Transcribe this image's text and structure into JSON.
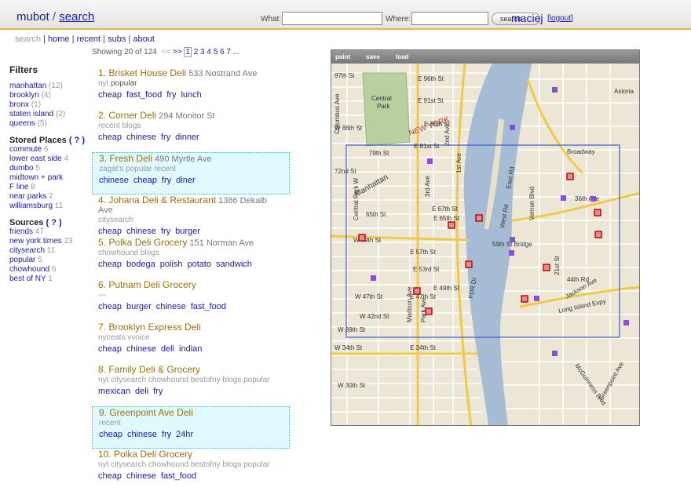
{
  "header": {
    "app": "mubot",
    "separator": "/",
    "section": "search",
    "what_label": "What:",
    "where_label": "Where:",
    "search_button": "search",
    "user": "maciej",
    "logout": "logout"
  },
  "nav": {
    "current": "search",
    "items": [
      "home",
      "recent",
      "subs",
      "about"
    ]
  },
  "sidebar": {
    "filters_title": "Filters",
    "filters": [
      {
        "label": "manhattan",
        "count": "(12)"
      },
      {
        "label": "brooklyn",
        "count": "(4)"
      },
      {
        "label": "bronx",
        "count": "(1)"
      },
      {
        "label": "staten island",
        "count": "(2)"
      },
      {
        "label": "queens",
        "count": "(5)"
      }
    ],
    "places_title": "Stored Places",
    "help": "( ? )",
    "places": [
      {
        "label": "commute",
        "count": "6"
      },
      {
        "label": "lower east side",
        "count": "4"
      },
      {
        "label": "dumbo",
        "count": "5"
      },
      {
        "label": "midtown + park",
        "count": ""
      },
      {
        "label": "F line",
        "count": "8"
      },
      {
        "label": "near parks",
        "count": "2"
      },
      {
        "label": "williamsburg",
        "count": "11"
      }
    ],
    "sources_title": "Sources",
    "sources": [
      {
        "label": "friends",
        "count": "47"
      },
      {
        "label": "new york times",
        "count": "23"
      },
      {
        "label": "citysearch",
        "count": "11"
      },
      {
        "label": "popular",
        "count": "5"
      },
      {
        "label": "chowhound",
        "count": "6"
      },
      {
        "label": "best of NY",
        "count": "1"
      }
    ]
  },
  "results": {
    "showing": "Showing 20 of 124",
    "prev": "<<",
    "next": ">>",
    "pages": [
      "1",
      "2",
      "3",
      "4",
      "5",
      "6",
      "7",
      "..."
    ],
    "items": [
      {
        "title": "1. Brisket House Deli",
        "addr": "533 Nostrand Ave",
        "src": "nyt",
        "pop": "popular",
        "tags": [
          "cheap",
          "fast_food",
          "fry",
          "lunch"
        ],
        "hl": false
      },
      {
        "title": "2. Corner Deli",
        "addr": "294 Monitor St",
        "src": "recent blogs",
        "pop": "",
        "tags": [
          "cheap",
          "chinese",
          "fry",
          "dinner"
        ],
        "hl": false
      },
      {
        "title": "3. Fresh Deli",
        "addr": "490 Myrtle Ave",
        "src": "zagat's popular recent",
        "pop": "",
        "tags": [
          "chinese",
          "cheap",
          "fry",
          "diner"
        ],
        "hl": true
      },
      {
        "title": "4. Johana Deli & Restaurant",
        "addr": "1386 Dekalb Ave",
        "src": "citysearch",
        "pop": "",
        "tags": [
          "cheap",
          "chinese",
          "fry",
          "burger"
        ],
        "hl": false
      },
      {
        "title": "5. Polka Deli Grocery",
        "addr": "151 Norman Ave",
        "src": "chowhound blogs",
        "pop": "",
        "tags": [
          "cheap",
          "bodega",
          "polish",
          "potato",
          "sandwich"
        ],
        "hl": false
      },
      {
        "title": "6. Putnam Deli Grocery",
        "addr": "",
        "src": "---",
        "pop": "",
        "tags": [
          "cheap",
          "burger",
          "chinese",
          "fast_food"
        ],
        "hl": false
      },
      {
        "title": "7. Brooklyn Express Deli",
        "addr": "",
        "src": "nyceats vvoice",
        "pop": "",
        "tags": [
          "cheap",
          "chinese",
          "deli",
          "indian"
        ],
        "hl": false
      },
      {
        "title": "8. Family Deli & Grocery",
        "addr": "",
        "src": "nyt citysearch chowhound bestofny blogs popular",
        "pop": "",
        "tags": [
          "mexican",
          "deli",
          "fry"
        ],
        "hl": false
      },
      {
        "title": "9. Greenpoint Ave Deli",
        "addr": "",
        "src": "recent",
        "pop": "",
        "tags": [
          "cheap",
          "chinese",
          "fry",
          "24hr"
        ],
        "hl": true
      },
      {
        "title": "10. Polka Deli Grocery",
        "addr": "",
        "src": "nyt citysearch chowhound bestofny blogs popular",
        "pop": "",
        "tags": [
          "cheap",
          "chinese",
          "fast_food"
        ],
        "hl": false
      }
    ]
  },
  "map": {
    "toolbar": [
      "paint",
      "save",
      "load"
    ],
    "labels": {
      "central_park": "Central",
      "central_park2": "Park",
      "new_york": "NEW YORK",
      "manhattan": "Manhattan",
      "broadway": "Broadway",
      "long_island": "Long Island Expy",
      "w34": "W 34th St",
      "e34": "E 34th St",
      "w59": "W 59th St",
      "bridge": "59th St Bridge",
      "fdr": "FDR Dr",
      "west_rd": "West Rd",
      "east_rd": "East Rd",
      "w97": "97th St",
      "e96": "E 96th St",
      "e91": "E 91st St",
      "e86": "E 86th St",
      "w86": "W 86th St",
      "e81": "E 81st St",
      "w79": "79th St",
      "w72": "72nd St",
      "w65": "65th St",
      "e67": "E 67th St",
      "e65": "E 65th St",
      "e57": "E 57th St",
      "e53": "E 53rd St",
      "e49": "E 49th St",
      "w47": "W 47th St",
      "e47": "E 47th St",
      "w42": "W 42nd St",
      "w39": "W 39th St",
      "w30": "W 30th St",
      "ave2": "2nd Ave",
      "ave3": "3rd Ave",
      "ave1": "1st Ave",
      "madison": "Madison Ave",
      "park": "Park Ave",
      "columbus": "Columbus Ave",
      "cpw": "Central Park W",
      "vernon": "Vernon Blvd",
      "ave21": "21st St",
      "st36": "36th Ave",
      "st44": "44th Rd",
      "jackson": "Jackson Ave",
      "greenpoint": "Greenpoint Ave",
      "mcguinness": "McGuinness Blvd",
      "astoria": "Astoria"
    }
  }
}
